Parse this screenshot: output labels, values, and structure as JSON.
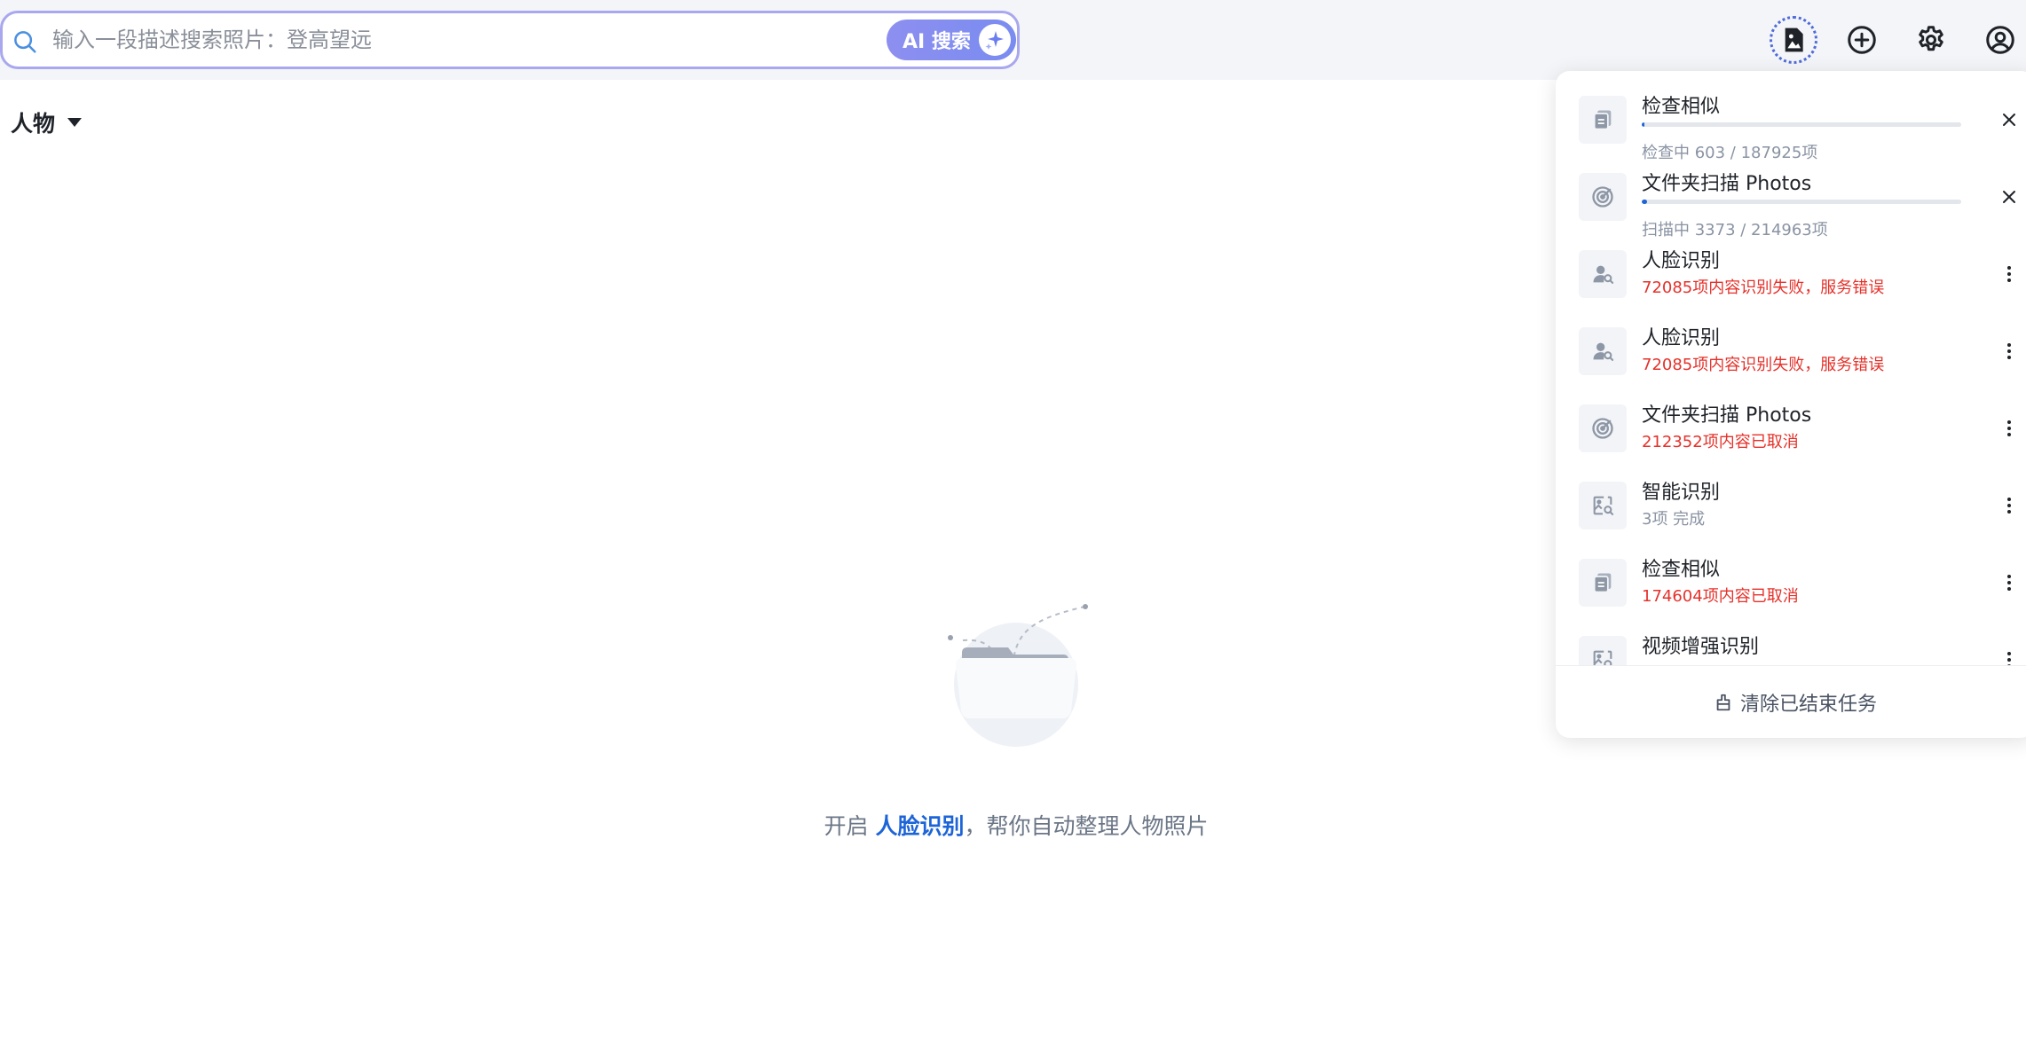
{
  "search": {
    "placeholder": "输入一段描述搜索照片：登高望远",
    "value": "",
    "ai_button_label": "AI 搜索"
  },
  "top_actions": [
    "task-center-icon",
    "add-icon",
    "gear-icon",
    "user-icon"
  ],
  "category": {
    "label": "人物"
  },
  "empty_state": {
    "prefix": "开启 ",
    "link": "人脸识别",
    "suffix": "，帮你自动整理人物照片"
  },
  "tasks": {
    "items": [
      {
        "name": "检查相似",
        "status": "检查中 603 / 187925项",
        "state": "running",
        "progress": 0.003,
        "icon": "copy-icon",
        "action": "close-icon"
      },
      {
        "name": "文件夹扫描 Photos",
        "status": "扫描中 3373 / 214963项",
        "state": "running",
        "progress": 0.016,
        "icon": "radar-icon",
        "action": "close-icon"
      },
      {
        "name": "人脸识别",
        "status": "72085项内容识别失败，服务错误",
        "state": "error",
        "icon": "face-search-icon",
        "action": "more-icon"
      },
      {
        "name": "人脸识别",
        "status": "72085项内容识别失败，服务错误",
        "state": "error",
        "icon": "face-search-icon",
        "action": "more-icon"
      },
      {
        "name": "文件夹扫描 Photos",
        "status": "212352项内容已取消",
        "state": "error",
        "icon": "radar-icon",
        "action": "more-icon"
      },
      {
        "name": "智能识别",
        "status": "3项 完成",
        "state": "done",
        "icon": "image-search-icon",
        "action": "more-icon"
      },
      {
        "name": "检查相似",
        "status": "174604项内容已取消",
        "state": "error",
        "icon": "copy-icon",
        "action": "more-icon"
      },
      {
        "name": "视频增强识别",
        "status": "",
        "state": "done",
        "icon": "image-search-icon",
        "action": "more-icon"
      }
    ],
    "clear_label": "清除已结束任务"
  },
  "colors": {
    "accent": "#1d64d8",
    "error": "#e5312a",
    "search_border": "#a9a7ee",
    "ai_gradient_start": "#8d8ff0"
  }
}
